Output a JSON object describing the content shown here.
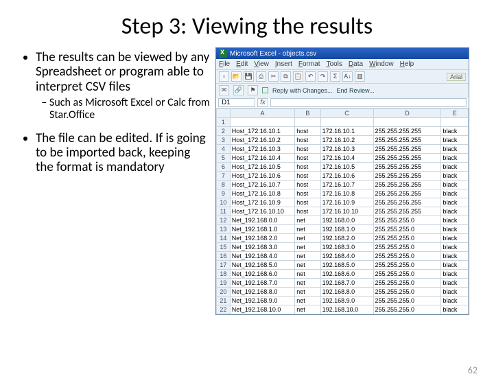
{
  "slide": {
    "title": "Step 3: Viewing the results",
    "bullet1": "The results can be viewed by any Spreadsheet or program able to interpret CSV files",
    "sub1": "Such as Microsoft Excel or Calc from Star.Office",
    "bullet2": "The file can be edited. If is going to be imported back, keeping the format is mandatory",
    "page_num": "62"
  },
  "excel": {
    "title": "Microsoft Excel - objects.csv",
    "menu": [
      "File",
      "Edit",
      "View",
      "Insert",
      "Format",
      "Tools",
      "Data",
      "Window",
      "Help"
    ],
    "side_label": "Arial",
    "review": {
      "reply": "Reply with Changes...",
      "end": "End Review..."
    },
    "namebox": "D1",
    "columns": [
      "",
      "A",
      "B",
      "C",
      "D",
      "E"
    ],
    "rows": [
      {
        "n": 1,
        "a": "",
        "b": "",
        "c": "",
        "d": "",
        "e": ""
      },
      {
        "n": 2,
        "a": "Host_172.16.10.1",
        "b": "host",
        "c": "172.16.10.1",
        "d": "255.255.255.255",
        "e": "black"
      },
      {
        "n": 3,
        "a": "Host_172.16.10.2",
        "b": "host",
        "c": "172.16.10.2",
        "d": "255.255.255.255",
        "e": "black"
      },
      {
        "n": 4,
        "a": "Host_172.16.10.3",
        "b": "host",
        "c": "172.16.10.3",
        "d": "255.255.255.255",
        "e": "black"
      },
      {
        "n": 5,
        "a": "Host_172.16.10.4",
        "b": "host",
        "c": "172.16.10.4",
        "d": "255.255.255.255",
        "e": "black"
      },
      {
        "n": 6,
        "a": "Host_172.16.10.5",
        "b": "host",
        "c": "172.16.10.5",
        "d": "255.255.255.255",
        "e": "black"
      },
      {
        "n": 7,
        "a": "Host_172.16.10.6",
        "b": "host",
        "c": "172.16.10.6",
        "d": "255.255.255.255",
        "e": "black"
      },
      {
        "n": 8,
        "a": "Host_172.16.10.7",
        "b": "host",
        "c": "172.16.10.7",
        "d": "255.255.255.255",
        "e": "black"
      },
      {
        "n": 9,
        "a": "Host_172.16.10.8",
        "b": "host",
        "c": "172.16.10.8",
        "d": "255.255.255.255",
        "e": "black"
      },
      {
        "n": 10,
        "a": "Host_172.16.10.9",
        "b": "host",
        "c": "172.16.10.9",
        "d": "255.255.255.255",
        "e": "black"
      },
      {
        "n": 11,
        "a": "Host_172.16.10.10",
        "b": "host",
        "c": "172.16.10.10",
        "d": "255.255.255.255",
        "e": "black"
      },
      {
        "n": 12,
        "a": "Net_192.168.0.0",
        "b": "net",
        "c": "192.168.0.0",
        "d": "255.255.255.0",
        "e": "black"
      },
      {
        "n": 13,
        "a": "Net_192.168.1.0",
        "b": "net",
        "c": "192.168.1.0",
        "d": "255.255.255.0",
        "e": "black"
      },
      {
        "n": 14,
        "a": "Net_192.168.2.0",
        "b": "net",
        "c": "192.168.2.0",
        "d": "255.255.255.0",
        "e": "black"
      },
      {
        "n": 15,
        "a": "Net_192.168.3.0",
        "b": "net",
        "c": "192.168.3.0",
        "d": "255.255.255.0",
        "e": "black"
      },
      {
        "n": 16,
        "a": "Net_192.168.4.0",
        "b": "net",
        "c": "192.168.4.0",
        "d": "255.255.255.0",
        "e": "black"
      },
      {
        "n": 17,
        "a": "Net_192.168.5.0",
        "b": "net",
        "c": "192.168.5.0",
        "d": "255.255.255.0",
        "e": "black"
      },
      {
        "n": 18,
        "a": "Net_192.168.6.0",
        "b": "net",
        "c": "192.168.6.0",
        "d": "255.255.255.0",
        "e": "black"
      },
      {
        "n": 19,
        "a": "Net_192.168.7.0",
        "b": "net",
        "c": "192.168.7.0",
        "d": "255.255.255.0",
        "e": "black"
      },
      {
        "n": 20,
        "a": "Net_192.168.8.0",
        "b": "net",
        "c": "192.168.8.0",
        "d": "255.255.255.0",
        "e": "black"
      },
      {
        "n": 21,
        "a": "Net_192.168.9.0",
        "b": "net",
        "c": "192.168.9.0",
        "d": "255.255.255.0",
        "e": "black"
      },
      {
        "n": 22,
        "a": "Net_192.168.10.0",
        "b": "net",
        "c": "192.168.10.0",
        "d": "255.255.255.0",
        "e": "black"
      }
    ]
  }
}
